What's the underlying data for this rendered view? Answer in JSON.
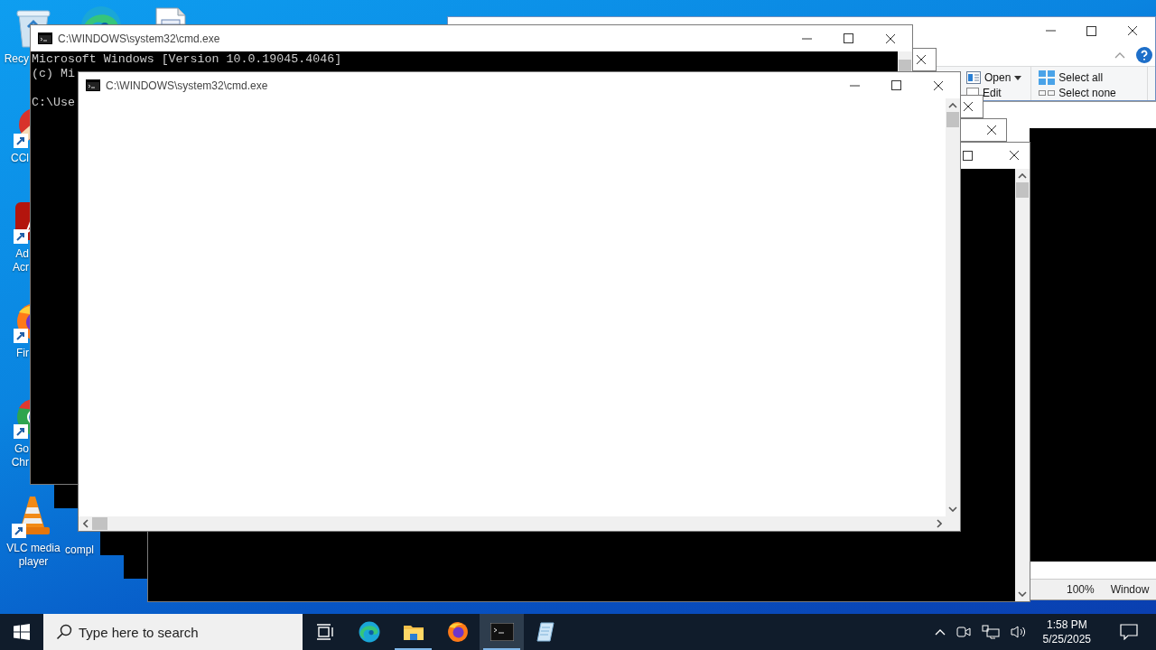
{
  "desktop_icons": [
    {
      "kind": "recycle-bin",
      "label_lines": [
        "Recy"
      ]
    },
    {
      "kind": "edge"
    },
    {
      "kind": "document"
    },
    {
      "kind": "ccleaner",
      "label_lines": [
        "CCl"
      ]
    },
    {
      "kind": "acrobat",
      "label_lines": [
        "Ad",
        "Acr"
      ]
    },
    {
      "kind": "firefox",
      "label_lines": [
        "Fir"
      ]
    },
    {
      "kind": "chrome",
      "label_lines": [
        "Go",
        "Chr"
      ]
    },
    {
      "kind": "vlc",
      "label_lines": [
        "VLC media",
        "player"
      ]
    },
    {
      "kind": "label-only",
      "label_lines": [
        "compl"
      ]
    }
  ],
  "explorer_window": {
    "ribbon": [
      {
        "kind": "open",
        "label": "Open"
      },
      {
        "kind": "edit",
        "label": "Edit"
      },
      {
        "kind": "select-all",
        "label": "Select all"
      },
      {
        "kind": "select-none",
        "label": "Select none"
      }
    ]
  },
  "notepad_window": {
    "status_bar": [
      "100%",
      "Window"
    ]
  },
  "cmd_windows": [
    {
      "kind": "console",
      "title": "C:\\WINDOWS\\system32\\cmd.exe",
      "lines": [
        {
          "text": "Microsoft Windows [Version 10.0.19045.4046]",
          "blank_before": false
        },
        {
          "text": "(c) Mi",
          "blank_before": false
        },
        {
          "text": "C:\\Use",
          "blank_before": true
        }
      ]
    },
    {
      "kind": "blank",
      "title": "C:\\WINDOWS\\system32\\cmd.exe"
    }
  ],
  "taskbar": {
    "search": {
      "placeholder": "Type here to search"
    },
    "apps": [
      {
        "kind": "task-view",
        "running": false,
        "active": false
      },
      {
        "kind": "edge",
        "running": false,
        "active": false
      },
      {
        "kind": "file-explorer",
        "running": true,
        "active": false
      },
      {
        "kind": "firefox",
        "running": false,
        "active": false
      },
      {
        "kind": "cmd",
        "running": true,
        "active": true
      },
      {
        "kind": "notepad",
        "running": false,
        "active": false
      }
    ],
    "time": "1:58 PM",
    "date": "5/25/2025"
  }
}
